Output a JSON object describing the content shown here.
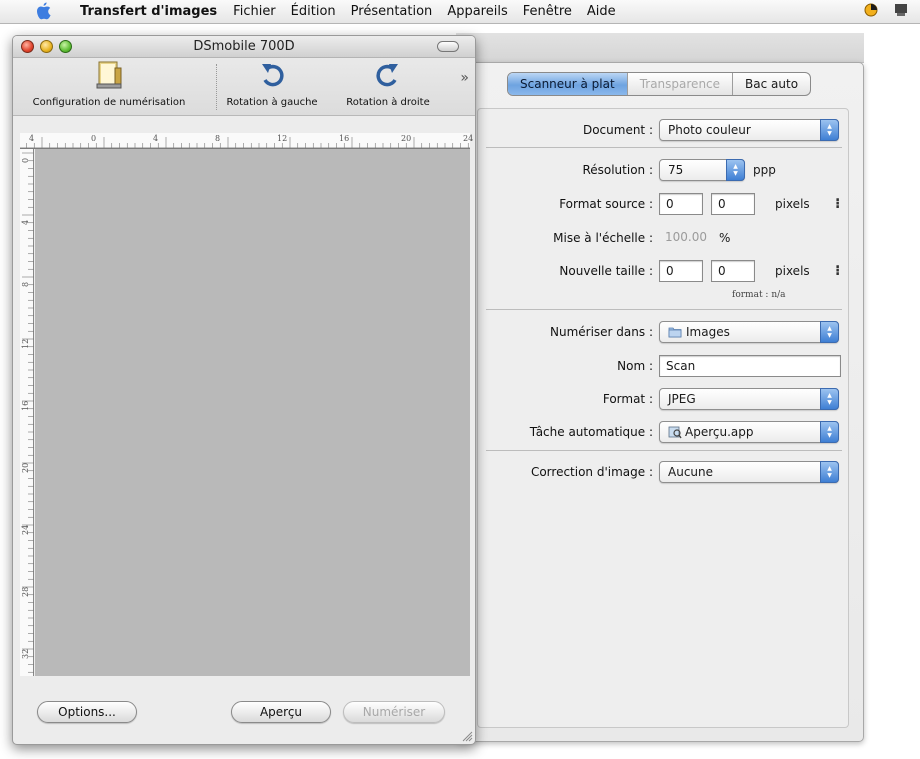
{
  "menubar": {
    "app_name": "Transfert d'images",
    "items": [
      "Fichier",
      "Édition",
      "Présentation",
      "Appareils",
      "Fenêtre",
      "Aide"
    ]
  },
  "scan_window": {
    "title": "DSmobile 700D",
    "toolbar": {
      "config_label": "Configuration de numérisation",
      "rotate_left_label": "Rotation à gauche",
      "rotate_right_label": "Rotation à droite",
      "more": "»"
    },
    "ruler_top_ticks": [
      "4",
      "0",
      "4",
      "8",
      "12",
      "16",
      "20",
      "24"
    ],
    "ruler_left_ticks": [
      "0",
      "4",
      "8",
      "12",
      "16",
      "20",
      "24",
      "28",
      "32"
    ],
    "buttons": {
      "options": "Options...",
      "preview": "Aperçu",
      "scan": "Numériser"
    }
  },
  "settings": {
    "tabs": [
      "Scanneur à plat",
      "Transparence",
      "Bac auto"
    ],
    "active_tab": "Scanneur à plat",
    "document": {
      "label": "Document :",
      "value": "Photo couleur"
    },
    "resolution": {
      "label": "Résolution :",
      "value": "75",
      "unit": "ppp"
    },
    "source_format": {
      "label": "Format  source :",
      "width": "0",
      "height": "0",
      "unit": "pixels"
    },
    "scale": {
      "label": "Mise à l'échelle :",
      "value": "100.00",
      "unit": "%"
    },
    "new_size": {
      "label": "Nouvelle taille :",
      "width": "0",
      "height": "0",
      "unit": "pixels"
    },
    "format_note": "format : n/a",
    "scan_to": {
      "label": "Numériser dans :",
      "value": "Images"
    },
    "name": {
      "label": "Nom :",
      "value": "Scan"
    },
    "file_format": {
      "label": "Format :",
      "value": "JPEG"
    },
    "auto_task": {
      "label": "Tâche automatique :",
      "value": "Aperçu.app"
    },
    "image_correction": {
      "label": "Correction d'image :",
      "value": "Aucune"
    }
  }
}
